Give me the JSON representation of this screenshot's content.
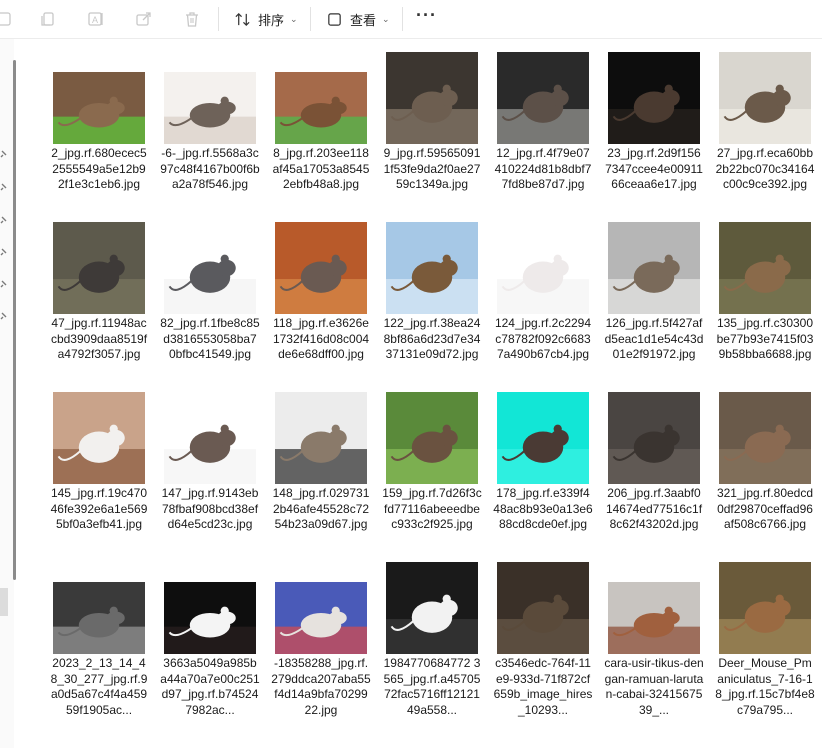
{
  "toolbar": {
    "sort_label": "排序",
    "view_label": "查看",
    "more_label": "···",
    "icons": [
      "cut-icon",
      "copy-icon",
      "rename-icon",
      "share-icon",
      "delete-icon",
      "sort-icon",
      "view-icon"
    ]
  },
  "files": [
    {
      "name": "2_jpg.rf.680ecec52555549a5e12b92f1e3c1eb6.jpg",
      "bg": "#7a5b42",
      "accent": "#5ccb3a",
      "animal": "#8a6a4e",
      "tall": false
    },
    {
      "name": "-6-_jpg.rf.5568a3c97c48f4167b00f6ba2a78f546.jpg",
      "bg": "#f4f1ee",
      "accent": "#d8cfc6",
      "animal": "#6e6259",
      "tall": false
    },
    {
      "name": "8_jpg.rf.203ee118af45a17053a85452ebfb48a8.jpg",
      "bg": "#a56a4a",
      "accent": "#4bbf4a",
      "animal": "#7a5236",
      "tall": false
    },
    {
      "name": "9_jpg.rf.595650911f53fe9da2f0ae2759c1349a.jpg",
      "bg": "#3c3630",
      "accent": "#8a7c6c",
      "animal": "#6d5e50",
      "tall": true
    },
    {
      "name": "12_jpg.rf.4f79e07410224d81b8dbf77fd8be87d7.jpg",
      "bg": "#2a2a2a",
      "accent": "#9a9a96",
      "animal": "#5c5048",
      "tall": true
    },
    {
      "name": "23_jpg.rf.2d9f1567347ccee4e0091166ceaa6e17.jpg",
      "bg": "#0d0d0d",
      "accent": "#2a2420",
      "animal": "#4a3a30",
      "tall": true
    },
    {
      "name": "27_jpg.rf.eca60bb2b22bc070c34164c00c9ce392.jpg",
      "bg": "#d9d6cf",
      "accent": "#efece6",
      "animal": "#6b5a4a",
      "tall": true
    },
    {
      "name": "47_jpg.rf.11948accbd3909daa8519fa4792f3057.jpg",
      "bg": "#5d5a4c",
      "accent": "#7a7660",
      "animal": "#3e3a38",
      "tall": true
    },
    {
      "name": "82_jpg.rf.1fbe8c85d3816553058ba70bfbc41549.jpg",
      "bg": "#ffffff",
      "accent": "#f2f2f2",
      "animal": "#5a5a5e",
      "tall": true
    },
    {
      "name": "118_jpg.rf.e3626e1732f416d08c004de6e68dff00.jpg",
      "bg": "#b85a2a",
      "accent": "#d98a4a",
      "animal": "#6a5a52",
      "tall": true
    },
    {
      "name": "122_jpg.rf.38ea248bf86a6d23d7e3437131e09d72.jpg",
      "bg": "#a6c8e6",
      "accent": "#dbeaf6",
      "animal": "#7a5a3a",
      "tall": true
    },
    {
      "name": "124_jpg.rf.2c2294c78782f092c66837a490b67cb4.jpg",
      "bg": "#ffffff",
      "accent": "#f4f4f4",
      "animal": "#eeeaea",
      "tall": true
    },
    {
      "name": "126_jpg.rf.5f427afd5eac1d1e54c43d01e2f91972.jpg",
      "bg": "#b6b6b6",
      "accent": "#e6e6e4",
      "animal": "#7a6a5a",
      "tall": true
    },
    {
      "name": "135_jpg.rf.c30300be77b93e7415f039b58bba6688.jpg",
      "bg": "#5e5a3c",
      "accent": "#7e7a56",
      "animal": "#8a6a4a",
      "tall": true
    },
    {
      "name": "145_jpg.rf.19c47046fe392e6a1e5695bf0a3efb41.jpg",
      "bg": "#c9a38a",
      "accent": "#8a5a3e",
      "animal": "#f2f0ee",
      "tall": true
    },
    {
      "name": "147_jpg.rf.9143eb78fbaf908bcd38efd64e5cd23c.jpg",
      "bg": "#ffffff",
      "accent": "#f4f4f4",
      "animal": "#6a5a52",
      "tall": true
    },
    {
      "name": "148_jpg.rf.0297312b46afe45528c7254b23a09d67.jpg",
      "bg": "#ececec",
      "accent": "#2a2a2a",
      "animal": "#8a7a6a",
      "tall": true
    },
    {
      "name": "159_jpg.rf.7d26f3cfd77116abeeedbec933c2f925.jpg",
      "bg": "#5a8a3a",
      "accent": "#8abf5a",
      "animal": "#6a5240",
      "tall": true
    },
    {
      "name": "178_jpg.rf.e339f448ac8b93e0a13e688cd8cde0ef.jpg",
      "bg": "#12e6d6",
      "accent": "#3af2e4",
      "animal": "#4a3a34",
      "tall": true
    },
    {
      "name": "206_jpg.rf.3aabf014674ed77516c1f8c62f43202d.jpg",
      "bg": "#4a4542",
      "accent": "#6a625c",
      "animal": "#3a3430",
      "tall": true
    },
    {
      "name": "321_jpg.rf.80edcd0df29870ceffad96af508c6766.jpg",
      "bg": "#6a5a4a",
      "accent": "#8a7660",
      "animal": "#8a6a52",
      "tall": true
    },
    {
      "name": "2023_2_13_14_48_30_277_jpg.rf.9a0d5a67c4f4a45959f1905ac...",
      "bg": "#3a3a3a",
      "accent": "#9a9a9a",
      "animal": "#6a6a6a",
      "tall": false
    },
    {
      "name": "3663a5049a985ba44a70a7e00c251d97_jpg.rf.b745247982ac...",
      "bg": "#0e0e0e",
      "accent": "#2a2020",
      "animal": "#f4f4f4",
      "tall": false
    },
    {
      "name": "-18358288_jpg.rf.279ddca207aba55f4d14a9bfa7029922.jpg",
      "bg": "#4a5ab8",
      "accent": "#d84a4a",
      "animal": "#e6e2de",
      "tall": false
    },
    {
      "name": "1984770684772 3565_jpg.rf.a4570572fac5716ff1212149a558...",
      "bg": "#1a1a1a",
      "accent": "#3a3a3a",
      "animal": "#f2f2f2",
      "tall": true
    },
    {
      "name": "c3546edc-764f-11e9-933d-71f872cf659b_image_hires_10293...",
      "bg": "#3a3028",
      "accent": "#6a5a48",
      "animal": "#5a4a3a",
      "tall": true
    },
    {
      "name": "cara-usir-tikus-dengan-ramuan-larutan-cabai-3241567539_...",
      "bg": "#c8c4c0",
      "accent": "#8a4a32",
      "animal": "#a0603e",
      "tall": false
    },
    {
      "name": "Deer_Mouse_Pmaniculatus_7-16-18_jpg.rf.15c7bf4e8c79a795...",
      "bg": "#6a5a3a",
      "accent": "#a48a5a",
      "animal": "#9a6a42",
      "tall": true
    }
  ]
}
